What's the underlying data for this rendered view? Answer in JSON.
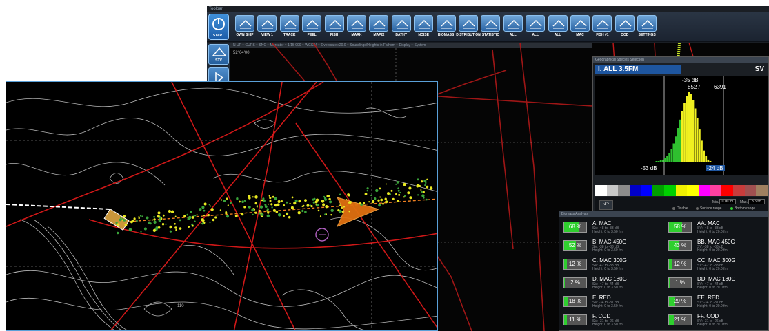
{
  "toolbar": {
    "title": "Toolbar",
    "start_label": "START",
    "buttons": [
      {
        "label": "OWN SHIP",
        "icon": "ship-icon"
      },
      {
        "label": "VIEW 1",
        "icon": "monitor-icon"
      },
      {
        "label": "TRACK",
        "icon": "track-icon"
      },
      {
        "label": "PEEL",
        "icon": "compass-icon"
      },
      {
        "label": "FISH",
        "icon": "fish-icon"
      },
      {
        "label": "MARK",
        "icon": "mark-icon"
      },
      {
        "label": "MAPIX",
        "icon": "mapix-icon"
      },
      {
        "label": "BATHY",
        "icon": "bathy-icon"
      },
      {
        "label": "NOISE",
        "icon": "noise-icon"
      },
      {
        "label": "BIOMASS",
        "icon": "biomass-icon"
      },
      {
        "label": "DISTRIBUTION",
        "icon": "distribution-icon"
      },
      {
        "label": "STATISTIC",
        "icon": "statistic-icon"
      },
      {
        "label": "ALL",
        "icon": "fish-icon"
      },
      {
        "label": "ALL",
        "icon": "fish-icon"
      },
      {
        "label": "ALL",
        "icon": "fish-icon"
      },
      {
        "label": "MAC",
        "icon": "fish-icon"
      },
      {
        "label": "FISH #1",
        "icon": "fish-icon"
      },
      {
        "label": "COD",
        "icon": "fish-icon"
      },
      {
        "label": "SETTINGS",
        "icon": "gear-icon"
      }
    ]
  },
  "sidebar": {
    "items": [
      {
        "label": "STV"
      },
      {
        "label": ""
      }
    ]
  },
  "map": {
    "status": "N UP ~ CURS ~ SNC ~ Mercator ~ 1/15 000 ~ WGS84 ~ Overscale x20.0 ~ Soundings/Heights in Fathom ~ Display ~ System",
    "lat_label": "52°04'00",
    "depth_label": "110",
    "right_label_1": "52",
    "right_label_2": "70"
  },
  "species_panel": {
    "title": "Geographical Species Selection",
    "header": "I. ALL 3.5FM",
    "unit": "SV",
    "peak_db": "-35 dB",
    "counts": "852 /",
    "total": "6391",
    "min_db": "-53 dB",
    "max_db": "-24 dB",
    "min_label": "Min.",
    "min_value": "0.00 fm",
    "max_label": "Max.",
    "max_value": "3.5 fm",
    "options": [
      "Disable",
      "Surface range",
      "Bottom range"
    ],
    "colorbar": [
      "#ffffff",
      "#c8c8c8",
      "#8c8c8c",
      "#0000c8",
      "#0000ff",
      "#00a000",
      "#00d000",
      "#f0f000",
      "#ffff00",
      "#ff00ff",
      "#ff40a0",
      "#ff0000",
      "#c83c3c",
      "#a05050",
      "#a08060"
    ],
    "histogram": [
      0,
      0,
      0,
      0,
      0,
      0,
      0,
      0,
      0,
      0,
      0,
      0,
      0,
      0,
      0,
      0,
      0,
      0,
      0,
      0,
      0,
      0,
      0,
      0,
      0,
      0,
      0,
      0,
      1,
      1,
      2,
      3,
      5,
      8,
      12,
      18,
      26,
      36,
      48,
      60,
      72,
      84,
      94,
      100,
      97,
      88,
      76,
      62,
      46,
      30,
      16,
      8,
      3,
      1,
      0,
      0,
      0,
      0,
      0,
      0,
      0,
      0,
      0,
      0,
      0,
      0,
      0,
      0,
      0,
      0,
      0,
      0,
      0,
      0,
      0,
      0,
      0,
      0,
      0,
      0
    ]
  },
  "biomass_panel": {
    "title": "Biomass Analysis",
    "items": [
      {
        "pct": 68,
        "pct_label": "68 %",
        "name": "A. MAC",
        "sv": "SV: -48 to -33 dB",
        "height": "Height: 0 to 3.50 fm"
      },
      {
        "pct": 58,
        "pct_label": "58 %",
        "name": "AA. MAC",
        "sv": "SV: -48 to -33 dB",
        "height": "Height: 0 to 20.0 fm"
      },
      {
        "pct": 52,
        "pct_label": "52 %",
        "name": "B. MAC 450G",
        "sv": "SV: -38 to -33 dB",
        "height": "Height: 0 to 3.50 fm"
      },
      {
        "pct": 43,
        "pct_label": "43 %",
        "name": "BB. MAC 450G",
        "sv": "SV: -38 to -33 dB",
        "height": "Height: 0 to 20.0 fm"
      },
      {
        "pct": 12,
        "pct_label": "12 %",
        "name": "C. MAC 300G",
        "sv": "SV: -42 to -38 dB",
        "height": "Height: 0 to 3.50 fm"
      },
      {
        "pct": 12,
        "pct_label": "12 %",
        "name": "CC. MAC 300G",
        "sv": "SV: -42 to -38 dB",
        "height": "Height: 0 to 20.0 fm"
      },
      {
        "pct": 2,
        "pct_label": "2 %",
        "name": "D. MAC 180G",
        "sv": "SV: -47 to -44 dB",
        "height": "Height: 0 to 3.50 fm"
      },
      {
        "pct": 1,
        "pct_label": "1 %",
        "name": "DD. MAC 180G",
        "sv": "SV: -47 to -44 dB",
        "height": "Height: 0 to 20.0 fm"
      },
      {
        "pct": 18,
        "pct_label": "18 %",
        "name": "E. RED",
        "sv": "SV: -34 to -31 dB",
        "height": "Height: 0 to 3.50 fm"
      },
      {
        "pct": 29,
        "pct_label": "29 %",
        "name": "EE. RED",
        "sv": "SV: -34 to -31 dB",
        "height": "Height: 0 to 20.0 fm"
      },
      {
        "pct": 11,
        "pct_label": "11 %",
        "name": "F. COD",
        "sv": "SV: -31 to -26 dB",
        "height": "Height: 0 to 3.50 fm"
      },
      {
        "pct": 21,
        "pct_label": "21 %",
        "name": "FF. COD",
        "sv": "SV: -31 to -26 dB",
        "height": "Height: 0 to 20.0 fm"
      }
    ]
  }
}
